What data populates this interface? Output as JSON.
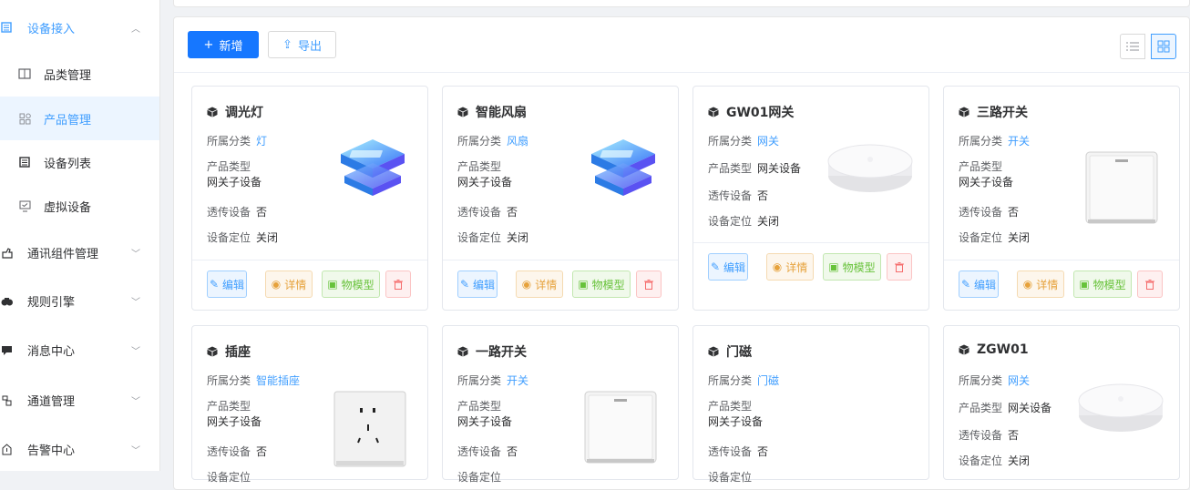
{
  "sidebar": {
    "items": [
      {
        "label": "设备接入",
        "icon": "device-access-icon",
        "expanded": true
      },
      {
        "label": "品类管理",
        "icon": "book-icon"
      },
      {
        "label": "产品管理",
        "icon": "product-grid-icon",
        "active": true
      },
      {
        "label": "设备列表",
        "icon": "list-icon"
      },
      {
        "label": "虚拟设备",
        "icon": "monitor-icon"
      },
      {
        "label": "通讯组件管理",
        "icon": "component-icon"
      },
      {
        "label": "规则引擎",
        "icon": "engine-icon"
      },
      {
        "label": "消息中心",
        "icon": "message-icon"
      },
      {
        "label": "通道管理",
        "icon": "channel-icon"
      },
      {
        "label": "告警中心",
        "icon": "alarm-icon"
      }
    ]
  },
  "toolbar": {
    "add_label": "新增",
    "add_icon": "+",
    "export_label": "导出",
    "view_mode": "card"
  },
  "labels": {
    "category": "所属分类",
    "type": "产品类型",
    "passthrough": "透传设备",
    "location": "设备定位",
    "edit": "编辑",
    "detail": "详情",
    "model": "物模型"
  },
  "products": [
    {
      "name": "调光灯",
      "category": "灯",
      "type": "网关子设备",
      "passthrough": "否",
      "location": "关闭",
      "image": "server-cube-image"
    },
    {
      "name": "智能风扇",
      "category": "风扇",
      "type": "网关子设备",
      "passthrough": "否",
      "location": "关闭",
      "image": "server-cube-image"
    },
    {
      "name": "GW01网关",
      "category": "网关",
      "type": "网关设备",
      "passthrough": "否",
      "location": "关闭",
      "image": "gateway-puck-image"
    },
    {
      "name": "三路开关",
      "category": "开关",
      "type": "网关子设备",
      "passthrough": "否",
      "location": "关闭",
      "image": "wall-switch-image"
    },
    {
      "name": "插座",
      "category": "智能插座",
      "type": "网关子设备",
      "passthrough": "否",
      "location": "",
      "image": "wall-socket-image"
    },
    {
      "name": "一路开关",
      "category": "开关",
      "type": "网关子设备",
      "passthrough": "否",
      "location": "",
      "image": "wall-switch-image"
    },
    {
      "name": "门磁",
      "category": "门磁",
      "type": "网关子设备",
      "passthrough": "否",
      "location": "",
      "image": "none"
    },
    {
      "name": "ZGW01",
      "category": "网关",
      "type": "网关设备",
      "passthrough": "否",
      "location": "关闭",
      "image": "gateway-puck-image"
    }
  ],
  "colors": {
    "primary": "#1677ff",
    "link": "#409eff",
    "detail": "#e6a23c",
    "model": "#67c23a",
    "delete": "#f56c6c"
  }
}
